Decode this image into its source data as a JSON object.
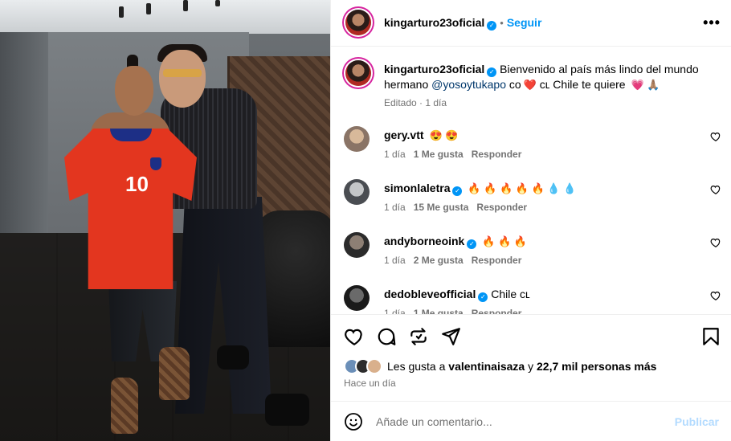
{
  "post": {
    "author": "kingarturo23oficial",
    "follow_label": "Seguir",
    "more_label": "•••",
    "caption_text": "Bienvenido al país más lindo del mundo hermano ",
    "caption_mention": "@yosoytukapo",
    "caption_tail": " co",
    "caption_tail2": " ᴄʟ Chile te quiere ",
    "caption_emojis_1": "❤️",
    "caption_emojis_2": "💗 🙏🏽",
    "caption_meta": "Editado · 1 día"
  },
  "comments": [
    {
      "user": "gery.vtt",
      "verified": false,
      "text": "😍 😍",
      "time": "1 día",
      "likes": "1 Me gusta",
      "reply": "Responder"
    },
    {
      "user": "simonlaletra",
      "verified": true,
      "text": "🔥 🔥 🔥 🔥 🔥 💧 💧",
      "time": "1 día",
      "likes": "15 Me gusta",
      "reply": "Responder"
    },
    {
      "user": "andyborneoink",
      "verified": true,
      "text": "🔥 🔥 🔥",
      "time": "1 día",
      "likes": "2 Me gusta",
      "reply": "Responder"
    },
    {
      "user": "dedobleveofficial",
      "verified": true,
      "text": "Chile ᴄʟ",
      "time": "1 día",
      "likes": "1 Me gusta",
      "reply": "Responder"
    }
  ],
  "likes": {
    "prefix": "Les gusta a ",
    "user": "valentinaisaza",
    "mid": " y ",
    "count": "22,7 mil personas más"
  },
  "posted_time": "Hace un día",
  "comment_box": {
    "placeholder": "Añade un comentario...",
    "publish_label": "Publicar"
  },
  "icons": {
    "like": "heart-icon",
    "comment": "comment-icon",
    "repost": "repost-icon",
    "share": "send-icon",
    "save": "bookmark-icon",
    "emoji": "emoji-icon",
    "verified": "verified-badge-icon"
  },
  "colors": {
    "accent": "#0095f6",
    "muted": "#737373",
    "publish_disabled": "#b3dbff",
    "mention": "#00376b"
  }
}
